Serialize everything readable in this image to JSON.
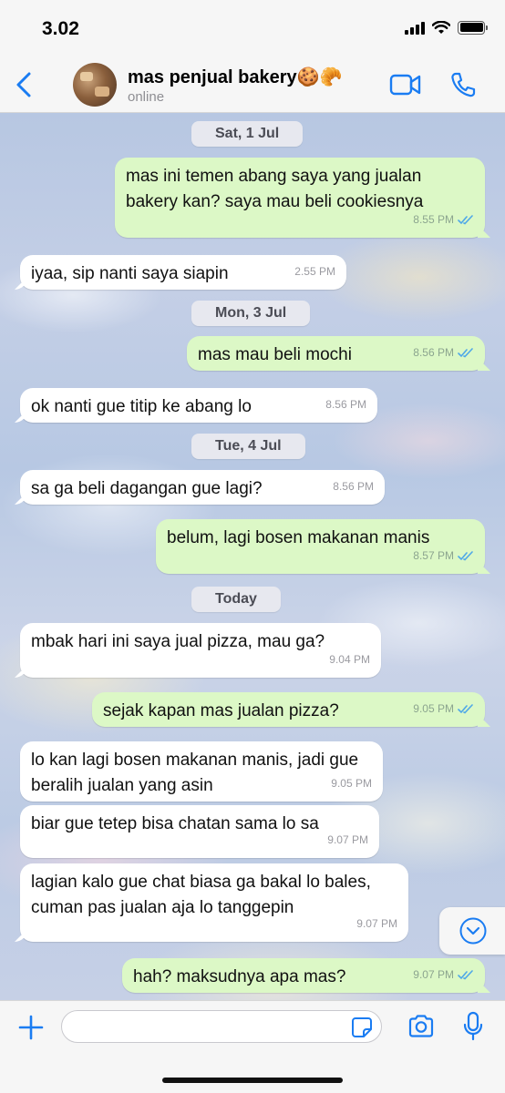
{
  "status_bar": {
    "time": "3.02"
  },
  "header": {
    "contact_name": "mas penjual bakery🍪🥐",
    "contact_status": "online"
  },
  "messages": [
    {
      "type": "date",
      "text": "Sat, 1 Jul"
    },
    {
      "type": "out",
      "text": "mas ini temen abang saya yang jualan bakery kan? saya mau beli cookiesnya",
      "time": "8.55 PM"
    },
    {
      "type": "in",
      "text": "iyaa, sip nanti saya siapin",
      "time": "2.55 PM"
    },
    {
      "type": "date",
      "text": "Mon, 3 Jul"
    },
    {
      "type": "out",
      "text": "mas mau beli mochi",
      "time": "8.56 PM"
    },
    {
      "type": "in",
      "text": "ok nanti gue titip ke abang lo",
      "time": "8.56 PM"
    },
    {
      "type": "date",
      "text": "Tue, 4 Jul"
    },
    {
      "type": "in",
      "text": "sa ga beli dagangan gue lagi?",
      "time": "8.56 PM"
    },
    {
      "type": "out",
      "text": "belum, lagi bosen makanan manis",
      "time": "8.57 PM"
    },
    {
      "type": "date",
      "text": "Today"
    },
    {
      "type": "in",
      "text": "mbak hari ini saya jual pizza, mau ga?",
      "time": "9.04 PM"
    },
    {
      "type": "out",
      "text": "sejak kapan mas jualan pizza?",
      "time": "9.05 PM"
    },
    {
      "type": "in",
      "text": "lo kan lagi bosen makanan manis, jadi gue beralih jualan yang asin",
      "time": "9.05 PM"
    },
    {
      "type": "in",
      "text": "biar gue tetep bisa chatan sama lo sa",
      "time": "9.07 PM"
    },
    {
      "type": "in",
      "text": "lagian kalo gue chat biasa ga bakal lo bales, cuman pas jualan aja lo tanggepin",
      "time": "9.07 PM"
    },
    {
      "type": "out",
      "text": "hah? maksudnya apa mas?",
      "time": "9.07 PM"
    }
  ],
  "input": {
    "placeholder": ""
  },
  "colors": {
    "accent": "#1a7cf2",
    "outgoing_bubble": "#dcf8c6",
    "incoming_bubble": "#ffffff",
    "read_ticks": "#4fa8e8"
  },
  "icons": {
    "back": "chevron-left-icon",
    "video": "video-camera-icon",
    "call": "phone-icon",
    "plus": "plus-icon",
    "sticker": "sticker-icon",
    "camera": "camera-icon",
    "mic": "microphone-icon",
    "scroll": "chevron-down-circle-icon"
  }
}
